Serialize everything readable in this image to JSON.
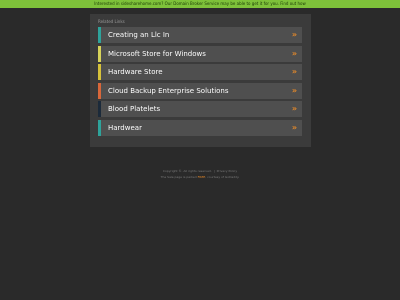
{
  "banner": {
    "text": "Interested in sidesharehome.com? Our Domain Broker Service may be able to get it for you. Find out how"
  },
  "related": {
    "title": "Related Links",
    "arrow": "»",
    "items": [
      {
        "label": "Creating an Llc In",
        "color": "#2ea39b"
      },
      {
        "label": "Microsoft Store for Windows",
        "color": "#d7d35a"
      },
      {
        "label": "Hardware Store",
        "color": "#d7c23a"
      },
      {
        "label": "Cloud Backup Enterprise Solutions",
        "color": "#d9673a"
      },
      {
        "label": "Blood Platelets",
        "color": "#1b2a3a"
      },
      {
        "label": "Hardwear",
        "color": "#2ea39b"
      }
    ]
  },
  "footer": {
    "copyright": "Copyright ©. All rights reserved.",
    "separator": "|",
    "privacy": "Privacy Policy",
    "notice_prefix": "The Sale page is parked ",
    "notice_link": "FREE",
    "notice_suffix": ", courtesy of GoDaddy."
  },
  "colors": {
    "background": "#2a2a2a",
    "panel": "#3b3b3b",
    "item": "#4f4f4f",
    "banner": "#7ec23a",
    "arrow": "#e5892a"
  }
}
